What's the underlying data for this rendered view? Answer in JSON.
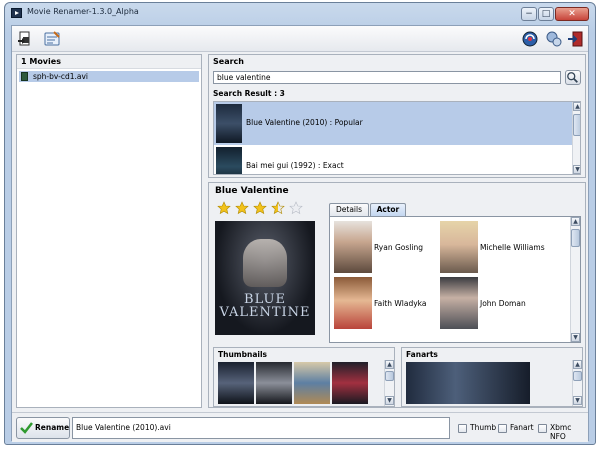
{
  "window": {
    "title": "Movie Renamer-1.3.0_Alpha",
    "min": "−",
    "max": "□",
    "close": "✕"
  },
  "toolbar": {
    "left_icons": [
      "open-folder-icon",
      "settings-icon"
    ],
    "right_icons": [
      "update-icon",
      "help-icon",
      "exit-icon"
    ]
  },
  "movies": {
    "header": "1 Movies",
    "items": [
      "sph-bv-cd1.avi"
    ]
  },
  "search": {
    "header": "Search",
    "query": "blue valentine",
    "result_label": "Search Result : 3",
    "results": [
      {
        "text": "Blue Valentine (2010) : Popular",
        "selected": true
      },
      {
        "text": "Bai mei gui (1992) : Exact",
        "selected": false
      }
    ]
  },
  "movie": {
    "title": "Blue Valentine",
    "rating_stars": 3.5,
    "rating_max": 5,
    "poster_text": "BLUE VALENTINE",
    "tabs": [
      "Details",
      "Actor"
    ],
    "active_tab": "Actor",
    "actors": [
      "Ryan Gosling",
      "Michelle Williams",
      "Faith Wladyka",
      "John Doman"
    ]
  },
  "thumbnails": {
    "header": "Thumbnails"
  },
  "fanarts": {
    "header": "Fanarts"
  },
  "bottom": {
    "rename_label": "Rename",
    "filename": "Blue Valentine (2010).avi",
    "checkboxes": [
      {
        "label": "Thumb",
        "checked": false
      },
      {
        "label": "Fanart",
        "checked": false
      },
      {
        "label": "Xbmc NFO",
        "checked": false
      }
    ]
  },
  "colors": {
    "selection": "#b7cbe8",
    "star": "#f2c21b",
    "accent": "#2f9a2f"
  }
}
